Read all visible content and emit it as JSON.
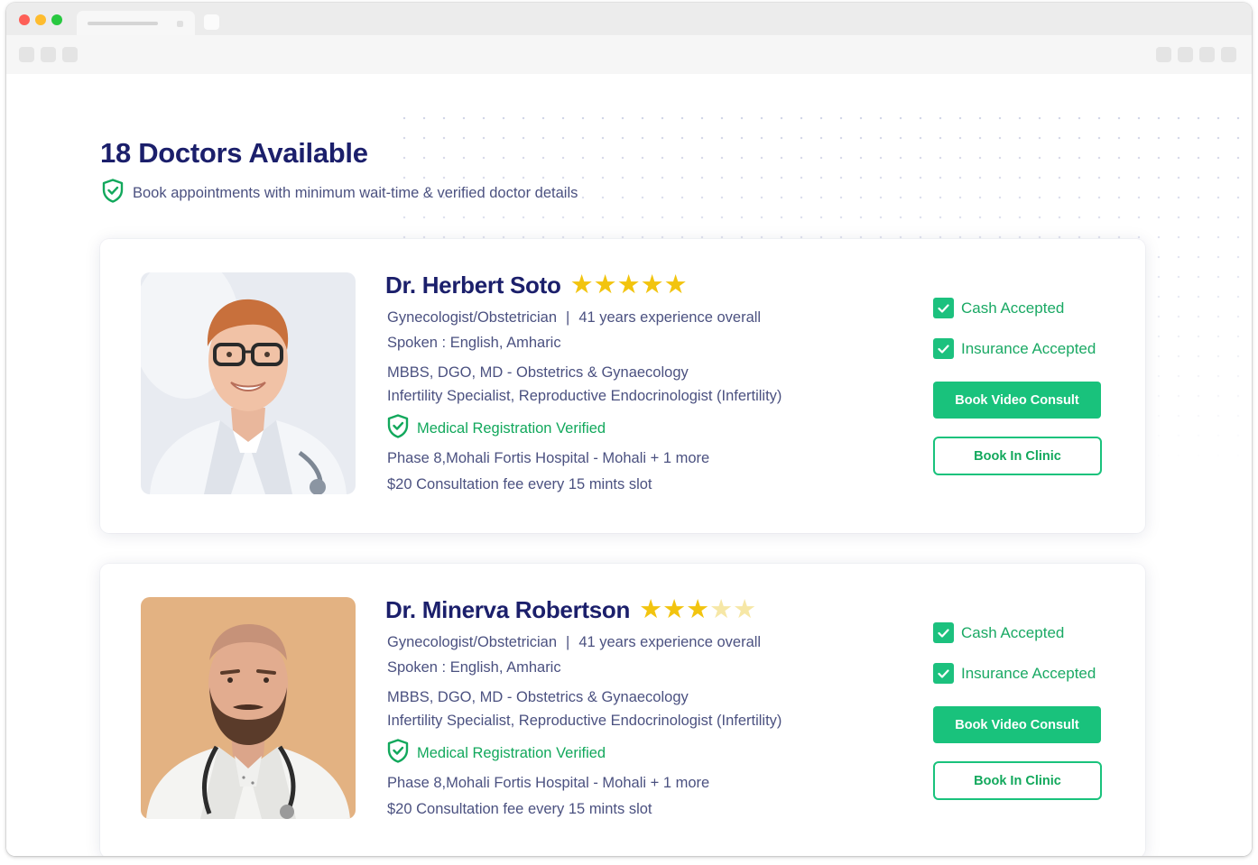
{
  "header": {
    "title": "18 Doctors Available",
    "subtitle": "Book appointments with minimum wait-time & verified doctor details"
  },
  "doctors": [
    {
      "name": "Dr. Herbert Soto",
      "rating": 5,
      "rating_max": 5,
      "specialty": "Gynecologist/Obstetrician",
      "experience": "41 years experience overall",
      "spoken": "Spoken : English, Amharic",
      "degrees": "MBBS, DGO, MD - Obstetrics & Gynaecology",
      "specializations": "Infertility Specialist, Reproductive Endocrinologist (Infertility)",
      "verified": "Medical Registration Verified",
      "location": "Phase 8,Mohali  Fortis Hospital - Mohali + 1 more",
      "fee": "$20 Consultation fee every 15 mints slot",
      "cash": "Cash Accepted",
      "insurance": "Insurance Accepted",
      "video_button": "Book Video Consult",
      "clinic_button": "Book In Clinic",
      "photo_background": "#e7eaf0"
    },
    {
      "name": "Dr. Minerva Robertson",
      "rating": 3,
      "rating_max": 5,
      "specialty": "Gynecologist/Obstetrician",
      "experience": "41 years experience overall",
      "spoken": "Spoken : English, Amharic",
      "degrees": "MBBS, DGO, MD - Obstetrics & Gynaecology",
      "specializations": "Infertility Specialist, Reproductive Endocrinologist (Infertility)",
      "verified": "Medical Registration Verified",
      "location": "Phase 8,Mohali  Fortis Hospital - Mohali + 1 more",
      "fee": "$20 Consultation fee every 15 mints slot",
      "cash": "Cash Accepted",
      "insurance": "Insurance Accepted",
      "video_button": "Book Video Consult",
      "clinic_button": "Book In Clinic",
      "photo_background": "#e3b282"
    }
  ],
  "icons": {
    "verified": "shield-check-icon",
    "checkbox": "checkbox-checked-icon",
    "star": "star-icon"
  },
  "colors": {
    "title": "#1b1f6b",
    "text": "#4b5180",
    "accent_green": "#19c27c",
    "star": "#f2c40f",
    "star_empty": "#f6e7a6"
  }
}
